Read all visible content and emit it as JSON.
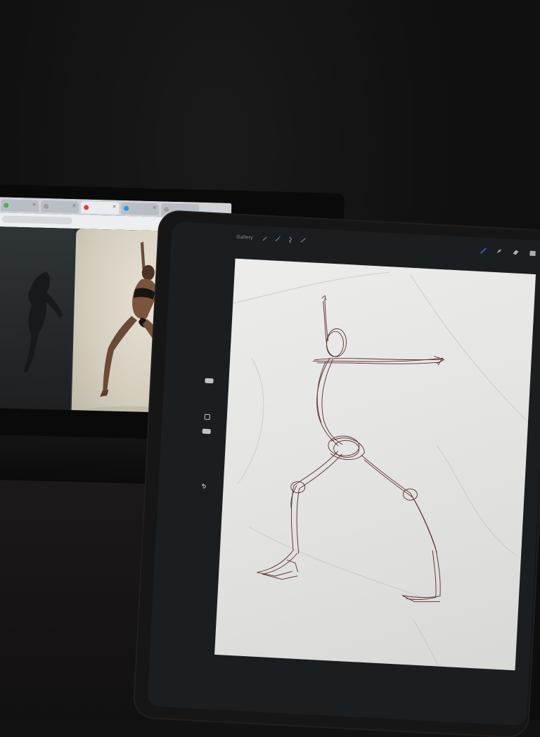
{
  "ipad_app": {
    "gallery_label": "Gallery",
    "toolbar_icons": [
      "wrench-icon",
      "magic-wand-icon",
      "selection-icon",
      "transform-icon",
      "brush-icon",
      "smudge-icon",
      "eraser-icon",
      "layers-icon"
    ],
    "sidebar_icons": [
      "undo-icon"
    ]
  },
  "laptop_browser": {
    "tab_count": 6,
    "tab_favicon_colors": [
      "#4caf50",
      "#9e9e9e",
      "#e53935",
      "#2196f3",
      "#9e9e9e",
      "#9e9e9e"
    ]
  },
  "colors": {
    "background": "#121212",
    "canvas": "#e6e7e4",
    "sketch_stroke": "#5a2b2b",
    "photo_backdrop": "#d8d2c3"
  }
}
